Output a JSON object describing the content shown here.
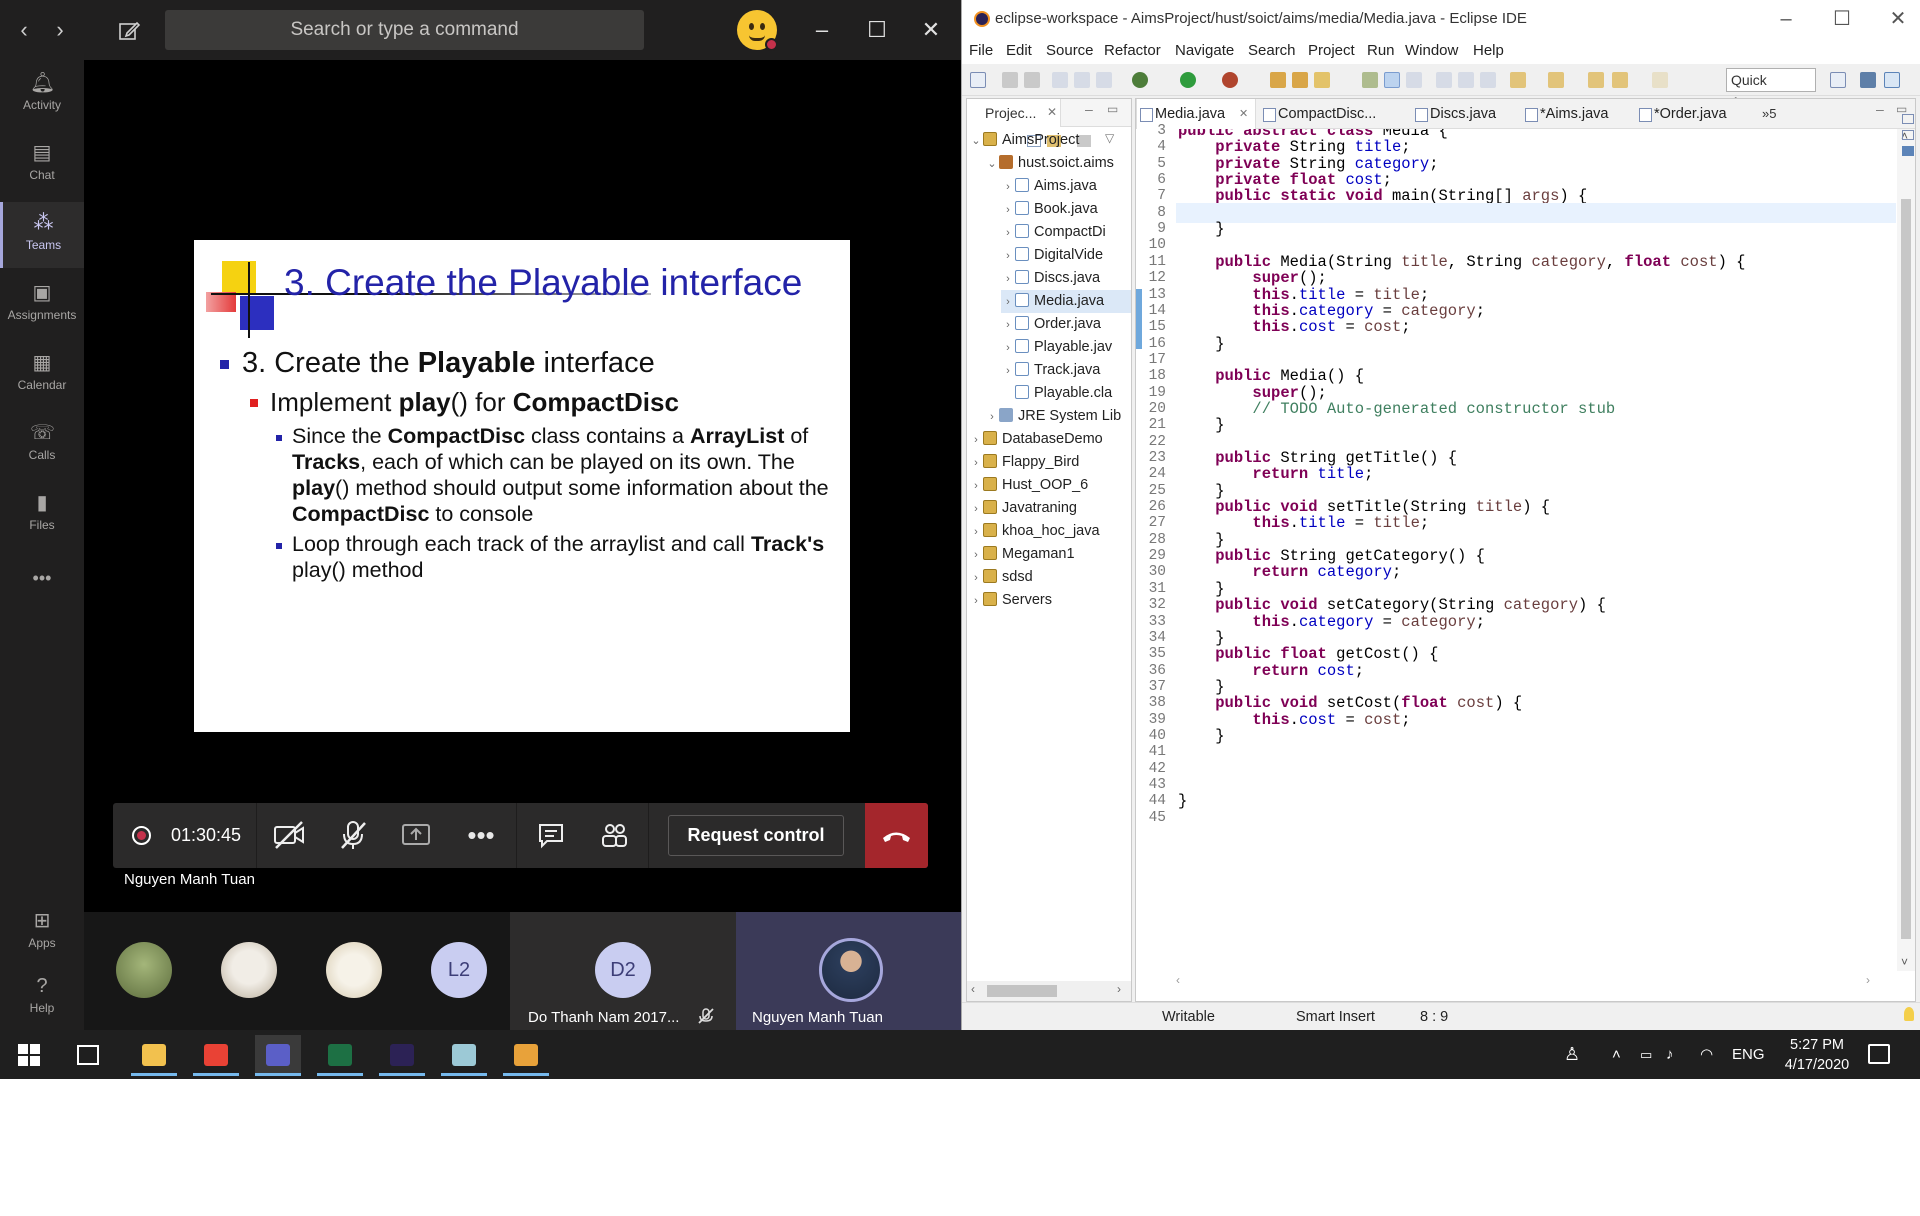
{
  "teams": {
    "search_placeholder": "Search or type a command",
    "rail": [
      {
        "label": "Activity",
        "icon": "bell-icon"
      },
      {
        "label": "Chat",
        "icon": "chat-icon"
      },
      {
        "label": "Teams",
        "icon": "teams-icon"
      },
      {
        "label": "Assignments",
        "icon": "assignments-icon"
      },
      {
        "label": "Calendar",
        "icon": "calendar-icon"
      },
      {
        "label": "Calls",
        "icon": "phone-icon"
      },
      {
        "label": "Files",
        "icon": "files-icon"
      }
    ],
    "rail_more": "•••",
    "rail_bottom": [
      {
        "label": "Apps",
        "icon": "apps-icon"
      },
      {
        "label": "Help",
        "icon": "help-icon"
      }
    ],
    "slide": {
      "title": "3. Create the Playable interface",
      "bullet1": {
        "pre": "3. Create the ",
        "bold": "Playable",
        "post": " interface"
      },
      "bullet2": {
        "pre": "Implement ",
        "bold1": "play",
        "mid": "() for ",
        "bold2": "CompactDisc"
      },
      "bullet3a": {
        "t1": "Since the ",
        "b1": "CompactDisc",
        "t2": " class contains a ",
        "b2": "ArrayList",
        "t3": " of ",
        "b3": "Tracks",
        "t4": ", each of which can be played on its own. The ",
        "b4": "play",
        "t5": "() method should output some information about the ",
        "b5": "CompactDisc",
        "t6": " to console"
      },
      "bullet3b": {
        "t1": "Loop through each track of the arraylist and call ",
        "b1": "Track's",
        "t2": " play() method"
      }
    },
    "call": {
      "timer": "01:30:45",
      "request_control": "Request control",
      "presenter": "Nguyen Manh Tuan"
    },
    "participants": [
      {
        "initials": "L2"
      },
      {
        "initials": "D2",
        "name": "Do Thanh Nam 2017..."
      },
      {
        "name": "Nguyen Manh Tuan"
      }
    ]
  },
  "eclipse": {
    "title": "eclipse-workspace - AimsProject/hust/soict/aims/media/Media.java - Eclipse IDE",
    "menu": [
      "File",
      "Edit",
      "Source",
      "Refactor",
      "Navigate",
      "Search",
      "Project",
      "Run",
      "Window",
      "Help"
    ],
    "quick_access": "Quick Access",
    "explorer_tab": "Projec...",
    "tree": [
      {
        "label": "AimsProject",
        "level": 0,
        "twisty": "⌄",
        "icon": "proj"
      },
      {
        "label": "hust.soict.aims",
        "level": 1,
        "twisty": "⌄",
        "icon": "pkg"
      },
      {
        "label": "Aims.java",
        "level": 2,
        "twisty": "›",
        "icon": "java"
      },
      {
        "label": "Book.java",
        "level": 2,
        "twisty": "›",
        "icon": "java"
      },
      {
        "label": "CompactDi",
        "level": 2,
        "twisty": "›",
        "icon": "java"
      },
      {
        "label": "DigitalVide",
        "level": 2,
        "twisty": "›",
        "icon": "java"
      },
      {
        "label": "Discs.java",
        "level": 2,
        "twisty": "›",
        "icon": "java"
      },
      {
        "label": "Media.java",
        "level": 2,
        "twisty": "›",
        "icon": "java",
        "selected": true
      },
      {
        "label": "Order.java",
        "level": 2,
        "twisty": "›",
        "icon": "java"
      },
      {
        "label": "Playable.jav",
        "level": 2,
        "twisty": "›",
        "icon": "java"
      },
      {
        "label": "Track.java",
        "level": 2,
        "twisty": "›",
        "icon": "java"
      },
      {
        "label": "Playable.cla",
        "level": 2,
        "twisty": "",
        "icon": "java"
      },
      {
        "label": "JRE System Lib",
        "level": 1,
        "twisty": "›",
        "icon": "lib"
      },
      {
        "label": "DatabaseDemo",
        "level": 0,
        "twisty": "›",
        "icon": "proj"
      },
      {
        "label": "Flappy_Bird",
        "level": 0,
        "twisty": "›",
        "icon": "proj"
      },
      {
        "label": "Hust_OOP_6",
        "level": 0,
        "twisty": "›",
        "icon": "proj"
      },
      {
        "label": "Javatraning",
        "level": 0,
        "twisty": "›",
        "icon": "proj"
      },
      {
        "label": "khoa_hoc_java",
        "level": 0,
        "twisty": "›",
        "icon": "proj"
      },
      {
        "label": "Megaman1",
        "level": 0,
        "twisty": "›",
        "icon": "proj"
      },
      {
        "label": "sdsd",
        "level": 0,
        "twisty": "›",
        "icon": "proj"
      },
      {
        "label": "Servers",
        "level": 0,
        "twisty": "›",
        "icon": "proj"
      }
    ],
    "tabs": [
      "Media.java",
      "CompactDisc...",
      "Discs.java",
      "*Aims.java",
      "*Order.java",
      "»5"
    ],
    "code": [
      {
        "n": "3",
        "html": "<span class=\"kw\">public abstract class</span> Media {"
      },
      {
        "n": "4",
        "html": "    <span class=\"kw\">private</span> String <span class=\"fd\">title</span>;"
      },
      {
        "n": "5",
        "html": "    <span class=\"kw\">private</span> String <span class=\"fd\">category</span>;"
      },
      {
        "n": "6",
        "html": "    <span class=\"kw\">private float</span> <span class=\"fd\">cost</span>;"
      },
      {
        "n": "7",
        "html": "    <span class=\"kw\">public static void</span> main(String[] <span class=\"pm\">args</span>) {"
      },
      {
        "n": "8",
        "html": "        ",
        "cur": true
      },
      {
        "n": "9",
        "html": "    }"
      },
      {
        "n": "10",
        "html": ""
      },
      {
        "n": "11",
        "html": "    <span class=\"kw\">public</span> Media(String <span class=\"pm\">title</span>, String <span class=\"pm\">category</span>, <span class=\"kw\">float</span> <span class=\"pm\">cost</span>) {"
      },
      {
        "n": "12",
        "html": "        <span class=\"kw\">super</span>();"
      },
      {
        "n": "13",
        "html": "        <span class=\"kw\">this</span>.<span class=\"fd\">title</span> = <span class=\"pm\">title</span>;"
      },
      {
        "n": "14",
        "html": "        <span class=\"kw\">this</span>.<span class=\"fd\">category</span> = <span class=\"pm\">category</span>;"
      },
      {
        "n": "15",
        "html": "        <span class=\"kw\">this</span>.<span class=\"fd\">cost</span> = <span class=\"pm\">cost</span>;"
      },
      {
        "n": "16",
        "html": "    }"
      },
      {
        "n": "17",
        "html": ""
      },
      {
        "n": "18",
        "html": "    <span class=\"kw\">public</span> Media() {"
      },
      {
        "n": "19",
        "html": "        <span class=\"kw\">super</span>();"
      },
      {
        "n": "20",
        "html": "        <span class=\"cm\">// TODO Auto-generated constructor stub</span>"
      },
      {
        "n": "21",
        "html": "    }"
      },
      {
        "n": "22",
        "html": ""
      },
      {
        "n": "23",
        "html": "    <span class=\"kw\">public</span> String getTitle() {"
      },
      {
        "n": "24",
        "html": "        <span class=\"kw\">return</span> <span class=\"fd\">title</span>;"
      },
      {
        "n": "25",
        "html": "    }"
      },
      {
        "n": "26",
        "html": "    <span class=\"kw\">public void</span> setTitle(String <span class=\"pm\">title</span>) {"
      },
      {
        "n": "27",
        "html": "        <span class=\"kw\">this</span>.<span class=\"fd\">title</span> = <span class=\"pm\">title</span>;"
      },
      {
        "n": "28",
        "html": "    }"
      },
      {
        "n": "29",
        "html": "    <span class=\"kw\">public</span> String getCategory() {"
      },
      {
        "n": "30",
        "html": "        <span class=\"kw\">return</span> <span class=\"fd\">category</span>;"
      },
      {
        "n": "31",
        "html": "    }"
      },
      {
        "n": "32",
        "html": "    <span class=\"kw\">public void</span> setCategory(String <span class=\"pm\">category</span>) {"
      },
      {
        "n": "33",
        "html": "        <span class=\"kw\">this</span>.<span class=\"fd\">category</span> = <span class=\"pm\">category</span>;"
      },
      {
        "n": "34",
        "html": "    }"
      },
      {
        "n": "35",
        "html": "    <span class=\"kw\">public float</span> getCost() {"
      },
      {
        "n": "36",
        "html": "        <span class=\"kw\">return</span> <span class=\"fd\">cost</span>;"
      },
      {
        "n": "37",
        "html": "    }"
      },
      {
        "n": "38",
        "html": "    <span class=\"kw\">public void</span> setCost(<span class=\"kw\">float</span> <span class=\"pm\">cost</span>) {"
      },
      {
        "n": "39",
        "html": "        <span class=\"kw\">this</span>.<span class=\"fd\">cost</span> = <span class=\"pm\">cost</span>;"
      },
      {
        "n": "40",
        "html": "    }"
      },
      {
        "n": "41",
        "html": ""
      },
      {
        "n": "42",
        "html": ""
      },
      {
        "n": "43",
        "html": ""
      },
      {
        "n": "44",
        "html": "}"
      },
      {
        "n": "45",
        "html": ""
      }
    ],
    "status": {
      "mode": "Writable",
      "insert": "Smart Insert",
      "position": "8 : 9"
    }
  },
  "taskbar": {
    "apps": [
      {
        "name": "file-explorer",
        "color": "#f2c14e"
      },
      {
        "name": "chrome",
        "color": "#e94235"
      },
      {
        "name": "teams",
        "color": "#5b5fc7"
      },
      {
        "name": "excel",
        "color": "#1d7044"
      },
      {
        "name": "eclipse",
        "color": "#2c2255"
      },
      {
        "name": "notepad",
        "color": "#9cc9d6"
      },
      {
        "name": "paint",
        "color": "#e8a23a"
      }
    ],
    "lang": "ENG",
    "time": "5:27 PM",
    "date": "4/17/2020"
  }
}
